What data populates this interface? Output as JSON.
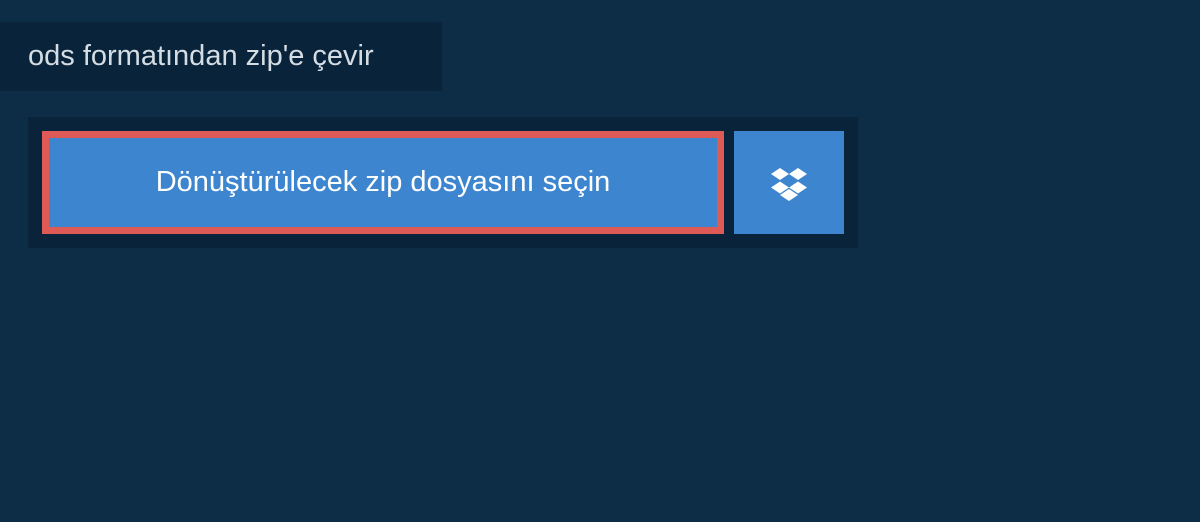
{
  "header": {
    "title": "ods formatından zip'e çevir"
  },
  "upload": {
    "file_select_label": "Dönüştürülecek zip dosyasını seçin",
    "dropbox_icon_name": "dropbox-icon"
  },
  "colors": {
    "background": "#0d2d47",
    "panel": "#09233a",
    "button": "#3d86cf",
    "button_border": "#dd5a56",
    "text_light": "#d5dde4",
    "text_white": "#ffffff"
  }
}
